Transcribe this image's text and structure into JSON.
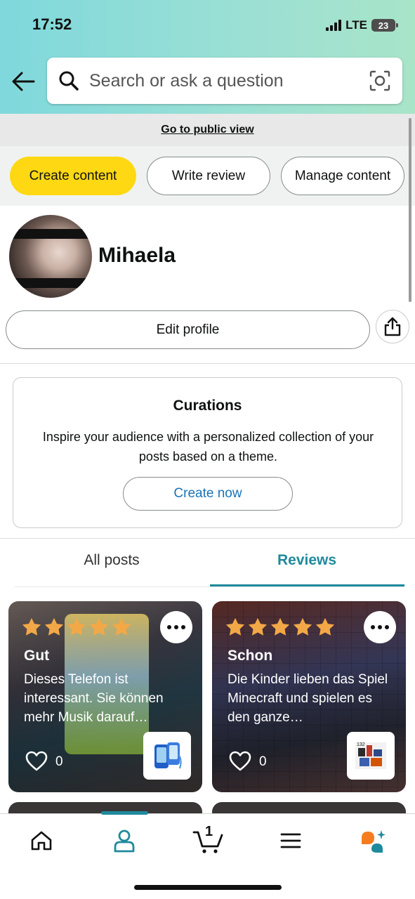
{
  "status_bar": {
    "time": "17:52",
    "network": "LTE",
    "battery": "23"
  },
  "search": {
    "placeholder": "Search or ask a question"
  },
  "public_view": {
    "link": "Go to public view"
  },
  "actions": {
    "create": "Create content",
    "write": "Write review",
    "manage": "Manage content"
  },
  "profile": {
    "name": "Mihaela",
    "edit": "Edit profile"
  },
  "curations": {
    "title": "Curations",
    "text": "Inspire your audience with a personalized collection of your posts based on a theme.",
    "button": "Create now"
  },
  "tabs": {
    "all": "All posts",
    "reviews": "Reviews",
    "active": "Reviews"
  },
  "reviews": [
    {
      "rating": 5,
      "title": "Gut",
      "text": "Dieses Telefon ist interessant. Sie können mehr Musik darauf…",
      "likes": "0"
    },
    {
      "rating": 5,
      "title": "Schon",
      "text": "Die Kinder lieben das Spiel Minecraft und spielen es den ganze…",
      "likes": "0"
    }
  ],
  "nav": {
    "cart_count": "1",
    "active": "profile"
  },
  "colors": {
    "accent": "#1f8a9c",
    "primary_button": "#ffd814",
    "star": "#f3a847",
    "link": "#1a73b8"
  }
}
